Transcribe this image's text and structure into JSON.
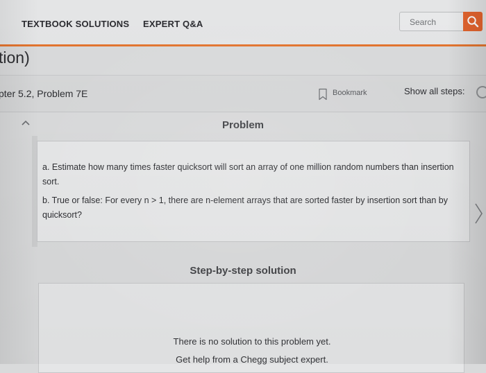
{
  "nav": {
    "textbook_solutions": "TEXTBOOK SOLUTIONS",
    "expert_qa": "EXPERT Q&A",
    "search_placeholder": "Search",
    "search_icon": "magnifier-icon"
  },
  "page": {
    "title": "tion)"
  },
  "chapter_bar": {
    "chapter_problem": "pter 5.2, Problem 7E",
    "bookmark_label": "Bookmark",
    "bookmark_icon": "bookmark-icon",
    "show_all_steps": "Show all steps:"
  },
  "problem": {
    "heading": "Problem",
    "part_a": "a. Estimate how many times faster quicksort will sort an array of one million random numbers than insertion sort.",
    "part_b": "b. True or false: For every n > 1, there are n-element arrays that are sorted faster by insertion sort than by quicksort?"
  },
  "solution": {
    "heading": "Step-by-step solution",
    "no_solution": "There is no solution to this problem yet.",
    "expert_help": "Get help from a Chegg subject expert."
  },
  "colors": {
    "accent": "#e3642e",
    "accent_bar": "#e3742f"
  }
}
